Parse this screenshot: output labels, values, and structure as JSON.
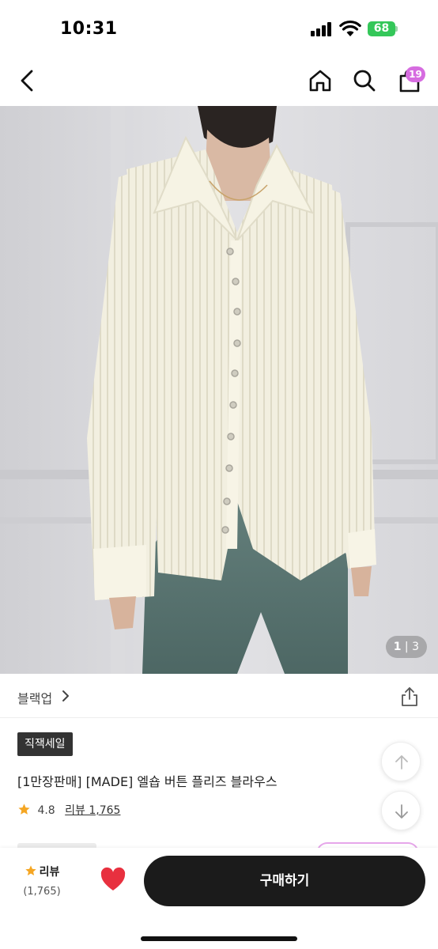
{
  "status_bar": {
    "time": "10:31",
    "battery": "68"
  },
  "header": {
    "cart_count": "19"
  },
  "image": {
    "counter_current": "1",
    "counter_separator": "|",
    "counter_total": "3"
  },
  "shop": {
    "name": "블랙업"
  },
  "product": {
    "badge": "직잭세일",
    "title": "[1만장판매] [MADE] 엘숍 버튼 플리즈 블라우스",
    "rating": "4.8",
    "review_link": "리뷰 1,765"
  },
  "bottom_bar": {
    "review_label": "리뷰",
    "review_count": "(1,765)",
    "buy_label": "구매하기"
  },
  "colors": {
    "accent_badge": "#d66ce0",
    "star": "#f5a623",
    "heart": "#e8303f",
    "buy_button": "#1b1b1b"
  }
}
